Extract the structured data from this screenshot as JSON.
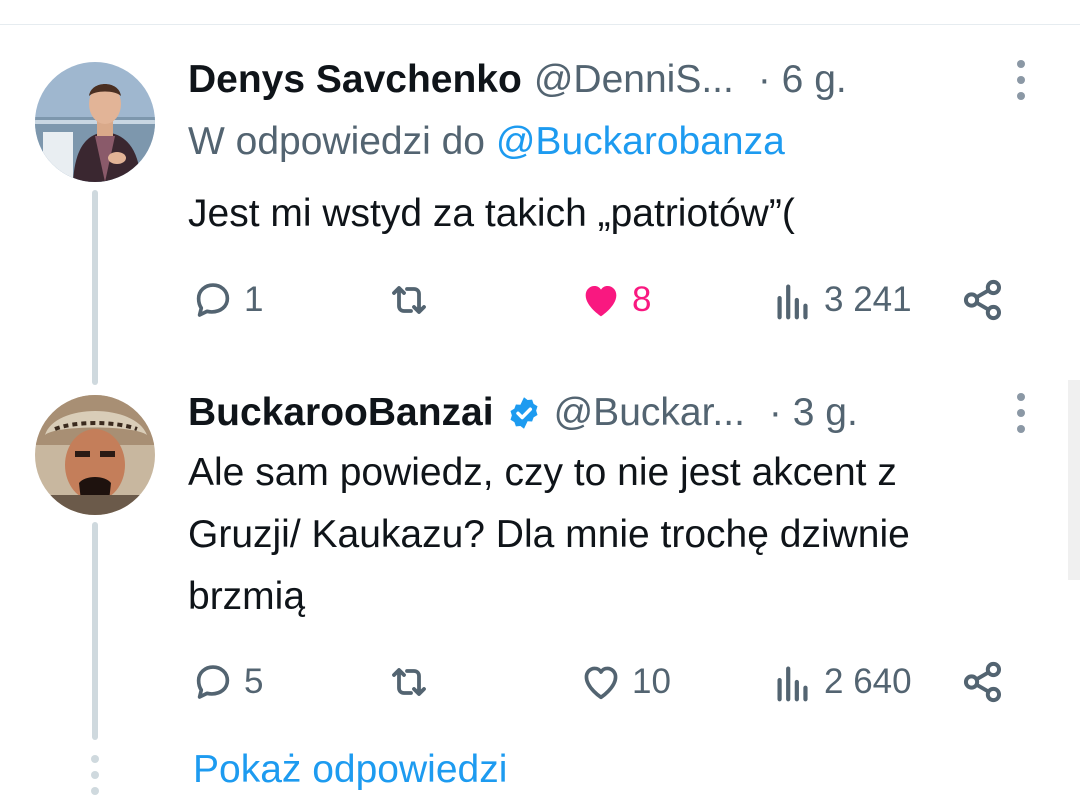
{
  "tweets": [
    {
      "display_name": "Denys Savchenko",
      "handle": "@DenniS...",
      "time": "· 6 g.",
      "reply_to_prefix": "W odpowiedzi do",
      "reply_to_mention": "@Buckarobanza",
      "text": "Jest mi wstyd za takich „patriotów”(",
      "replies": "1",
      "likes": "8",
      "liked": true,
      "views": "3 241"
    },
    {
      "display_name": "BuckarooBanzai",
      "verified": true,
      "handle": "@Buckar...",
      "time": "· 3 g.",
      "text_lines": [
        "Ale sam powiedz, czy to nie jest akcent z",
        "Gruzji/ Kaukazu? Dla mnie trochę dziwnie",
        "brzmią"
      ],
      "replies": "5",
      "likes": "10",
      "liked": false,
      "views": "2 640"
    }
  ],
  "show_replies_label": "Pokaż odpowiedzi",
  "colors": {
    "accent": "#1d9bf0",
    "like_active": "#f91880",
    "secondary_text": "#536471",
    "thread_line": "#cfd9de"
  },
  "icons": {
    "reply": "speech-bubble-icon",
    "retweet": "retweet-icon",
    "like": "heart-icon",
    "views": "bar-chart-icon",
    "share": "share-icon",
    "more": "vertical-dots-icon",
    "verified": "verified-badge-icon"
  }
}
